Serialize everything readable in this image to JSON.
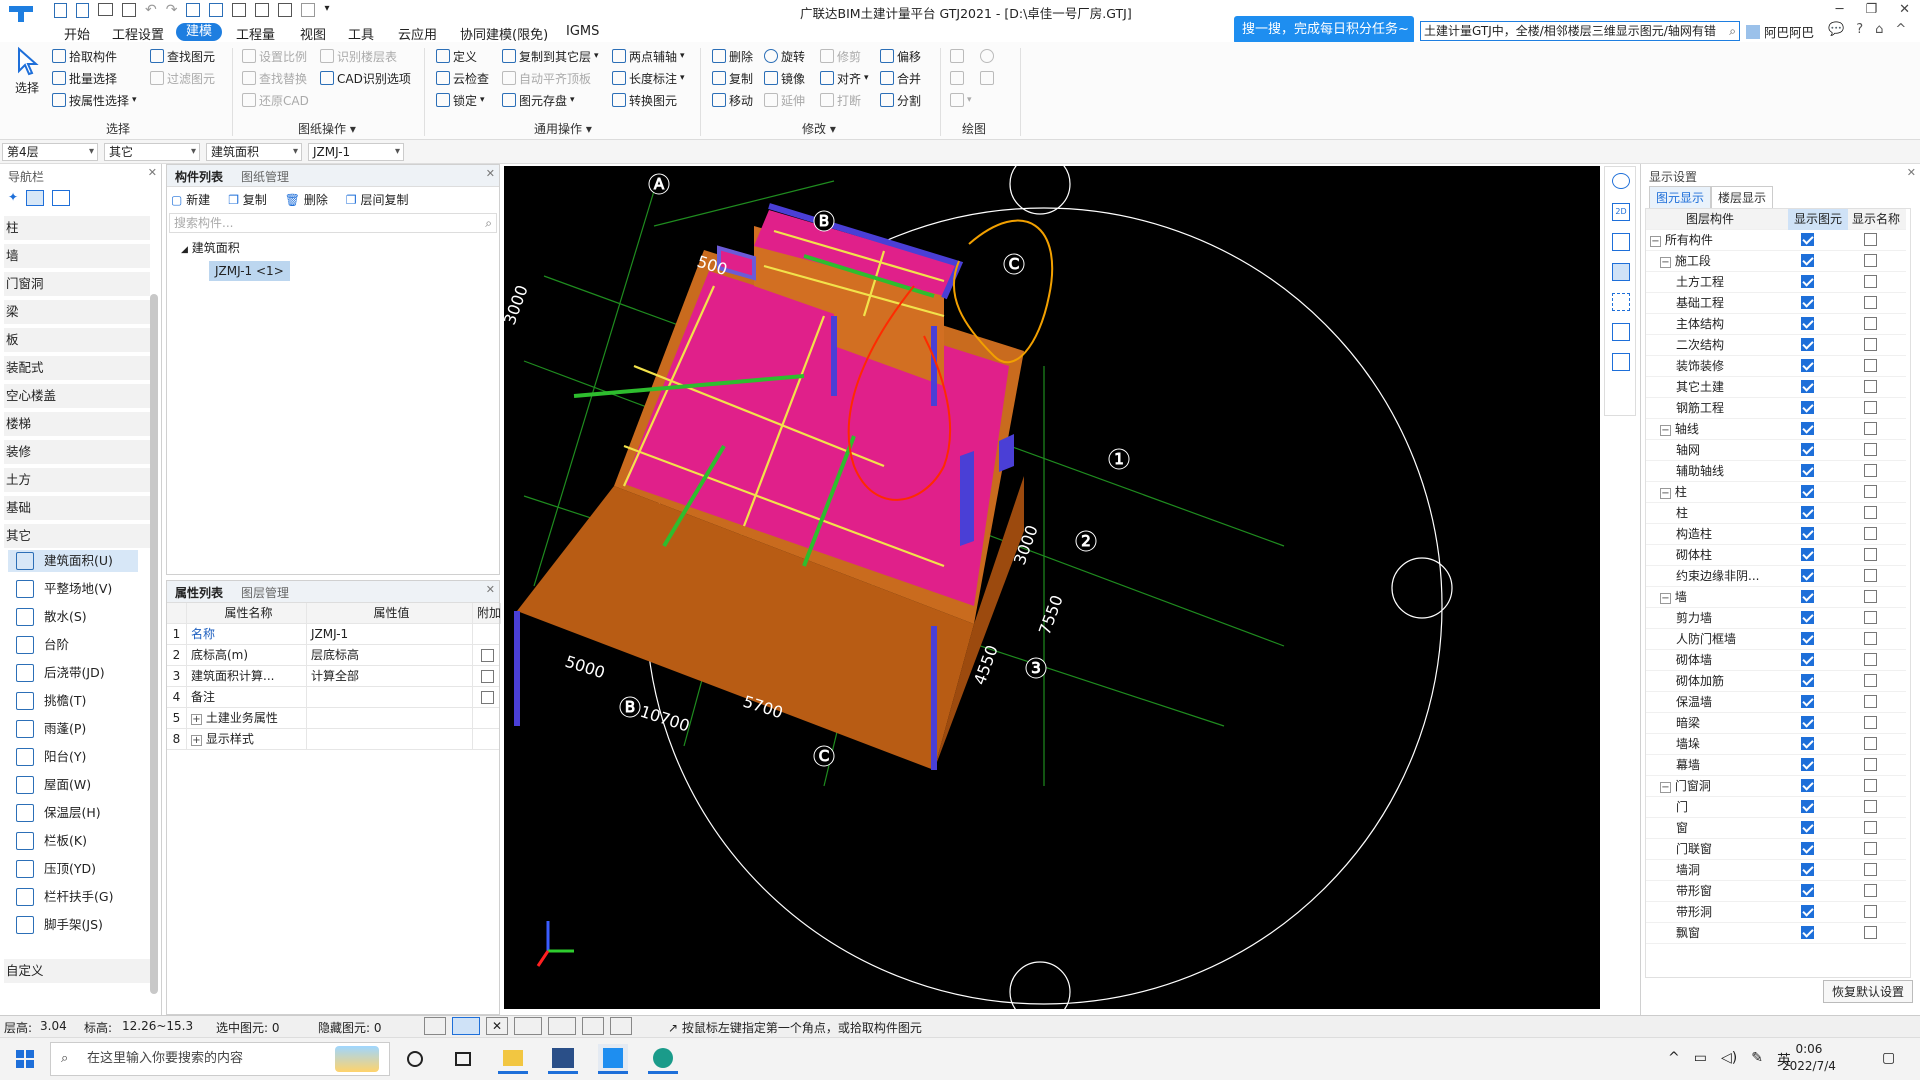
{
  "title": {
    "text": "广联达BIM土建计量平台 GTJ2021 - [D:\\卓佳一号厂房.GTJ]"
  },
  "promo": {
    "text": "搜一搜，完成每日积分任务~"
  },
  "search": {
    "value": "土建计量GTJ中，全楼/相邻楼层三维显示图元/轴网有错"
  },
  "user": {
    "name": "阿巴阿巴"
  },
  "tabs": [
    "开始",
    "工程设置",
    "建模",
    "工程量",
    "视图",
    "工具",
    "云应用",
    "协同建模(限免)",
    "IGMS"
  ],
  "ribbon": {
    "select": "选择",
    "select_group": {
      "items": [
        "拾取构件",
        "批量选择",
        "按属性选择",
        "查找图元",
        "过滤图元"
      ],
      "label": "选择"
    },
    "drawing_group": {
      "items": [
        "设置比例",
        "识别楼层表",
        "查找替换",
        "CAD识别选项",
        "还原CAD"
      ],
      "label": "图纸操作"
    },
    "general_group": {
      "items": [
        "定义",
        "复制到其它层",
        "两点辅轴",
        "云检查",
        "自动平齐顶板",
        "长度标注",
        "锁定",
        "图元存盘",
        "转换图元"
      ],
      "label": "通用操作"
    },
    "modify_group": {
      "items": [
        "删除",
        "旋转",
        "修剪",
        "偏移",
        "复制",
        "镜像",
        "对齐",
        "合并",
        "移动",
        "延伸",
        "打断",
        "分割"
      ],
      "label": "修改"
    },
    "draw_group": {
      "label": "绘图"
    }
  },
  "filters": [
    "第4层",
    "其它",
    "建筑面积",
    "JZMJ-1"
  ],
  "nav": {
    "title": "导航栏",
    "cats": [
      "柱",
      "墙",
      "门窗洞",
      "梁",
      "板",
      "装配式",
      "空心楼盖",
      "楼梯",
      "装修",
      "土方",
      "基础",
      "其它"
    ],
    "items": [
      "建筑面积(U)",
      "平整场地(V)",
      "散水(S)",
      "台阶",
      "后浇带(JD)",
      "挑檐(T)",
      "雨蓬(P)",
      "阳台(Y)",
      "屋面(W)",
      "保温层(H)",
      "栏板(K)",
      "压顶(YD)",
      "栏杆扶手(G)",
      "脚手架(JS)"
    ],
    "custom": "自定义"
  },
  "comp": {
    "tabs": [
      "构件列表",
      "图纸管理"
    ],
    "actions": [
      "新建",
      "复制",
      "删除",
      "层间复制"
    ],
    "search_placeholder": "搜索构件...",
    "tree_root": "建筑面积",
    "tree_item": "JZMJ-1 <1>"
  },
  "props": {
    "tabs": [
      "属性列表",
      "图层管理"
    ],
    "headers": [
      "属性名称",
      "属性值",
      "附加"
    ],
    "rows": [
      {
        "no": "1",
        "name": "名称",
        "value": "JZMJ-1",
        "cb": false,
        "hascb": false
      },
      {
        "no": "2",
        "name": "底标高(m)",
        "value": "层底标高",
        "cb": false,
        "hascb": true
      },
      {
        "no": "3",
        "name": "建筑面积计算...",
        "value": "计算全部",
        "cb": false,
        "hascb": true
      },
      {
        "no": "4",
        "name": "备注",
        "value": "",
        "cb": false,
        "hascb": true
      },
      {
        "no": "5",
        "name": "土建业务属性",
        "value": "",
        "cb": false,
        "hascb": false
      },
      {
        "no": "8",
        "name": "显示样式",
        "value": "",
        "cb": false,
        "hascb": false
      }
    ]
  },
  "viewport": {
    "axis_labels": [
      "A",
      "B",
      "C",
      "1",
      "2",
      "3",
      "1",
      "2",
      "3",
      "A",
      "B",
      "C"
    ],
    "dims": [
      "500",
      "3000",
      "7550",
      "4550",
      "5000",
      "5700",
      "10700",
      "3000",
      "7550",
      "4550"
    ]
  },
  "display": {
    "title": "显示设置",
    "tabs": [
      "图元显示",
      "楼层显示"
    ],
    "headers": [
      "图层构件",
      "显示图元",
      "显示名称"
    ],
    "rows": [
      {
        "t": "所有构件",
        "lvl": 0,
        "exp": "−",
        "a": true,
        "b": false
      },
      {
        "t": "施工段",
        "lvl": 1,
        "exp": "−",
        "a": true,
        "b": false
      },
      {
        "t": "土方工程",
        "lvl": 2,
        "exp": "",
        "a": true,
        "b": false
      },
      {
        "t": "基础工程",
        "lvl": 2,
        "exp": "",
        "a": true,
        "b": false
      },
      {
        "t": "主体结构",
        "lvl": 2,
        "exp": "",
        "a": true,
        "b": false
      },
      {
        "t": "二次结构",
        "lvl": 2,
        "exp": "",
        "a": true,
        "b": false
      },
      {
        "t": "装饰装修",
        "lvl": 2,
        "exp": "",
        "a": true,
        "b": false
      },
      {
        "t": "其它土建",
        "lvl": 2,
        "exp": "",
        "a": true,
        "b": false
      },
      {
        "t": "钢筋工程",
        "lvl": 2,
        "exp": "",
        "a": true,
        "b": false
      },
      {
        "t": "轴线",
        "lvl": 1,
        "exp": "−",
        "a": true,
        "b": false
      },
      {
        "t": "轴网",
        "lvl": 2,
        "exp": "",
        "a": true,
        "b": false
      },
      {
        "t": "辅助轴线",
        "lvl": 2,
        "exp": "",
        "a": true,
        "b": false
      },
      {
        "t": "柱",
        "lvl": 1,
        "exp": "−",
        "a": true,
        "b": false
      },
      {
        "t": "柱",
        "lvl": 2,
        "exp": "",
        "a": true,
        "b": false
      },
      {
        "t": "构造柱",
        "lvl": 2,
        "exp": "",
        "a": true,
        "b": false
      },
      {
        "t": "砌体柱",
        "lvl": 2,
        "exp": "",
        "a": true,
        "b": false
      },
      {
        "t": "约束边缘非阴...",
        "lvl": 2,
        "exp": "",
        "a": true,
        "b": false
      },
      {
        "t": "墙",
        "lvl": 1,
        "exp": "−",
        "a": true,
        "b": false
      },
      {
        "t": "剪力墙",
        "lvl": 2,
        "exp": "",
        "a": true,
        "b": false
      },
      {
        "t": "人防门框墙",
        "lvl": 2,
        "exp": "",
        "a": true,
        "b": false
      },
      {
        "t": "砌体墙",
        "lvl": 2,
        "exp": "",
        "a": true,
        "b": false
      },
      {
        "t": "砌体加筋",
        "lvl": 2,
        "exp": "",
        "a": true,
        "b": false
      },
      {
        "t": "保温墙",
        "lvl": 2,
        "exp": "",
        "a": true,
        "b": false
      },
      {
        "t": "暗梁",
        "lvl": 2,
        "exp": "",
        "a": true,
        "b": false
      },
      {
        "t": "墙垛",
        "lvl": 2,
        "exp": "",
        "a": true,
        "b": false
      },
      {
        "t": "幕墙",
        "lvl": 2,
        "exp": "",
        "a": true,
        "b": false
      },
      {
        "t": "门窗洞",
        "lvl": 1,
        "exp": "−",
        "a": true,
        "b": false
      },
      {
        "t": "门",
        "lvl": 2,
        "exp": "",
        "a": true,
        "b": false
      },
      {
        "t": "窗",
        "lvl": 2,
        "exp": "",
        "a": true,
        "b": false
      },
      {
        "t": "门联窗",
        "lvl": 2,
        "exp": "",
        "a": true,
        "b": false
      },
      {
        "t": "墙洞",
        "lvl": 2,
        "exp": "",
        "a": true,
        "b": false
      },
      {
        "t": "带形窗",
        "lvl": 2,
        "exp": "",
        "a": true,
        "b": false
      },
      {
        "t": "带形洞",
        "lvl": 2,
        "exp": "",
        "a": true,
        "b": false
      },
      {
        "t": "飘窗",
        "lvl": 2,
        "exp": "",
        "a": true,
        "b": false
      }
    ],
    "restore": "恢复默认设置"
  },
  "status": {
    "floor_h": "层高:",
    "floor_h_val": "3.04",
    "elev": "标高:",
    "elev_val": "12.26~15.3",
    "sel": "选中图元: 0",
    "hidden": "隐藏图元: 0",
    "hint": "按鼠标左键指定第一个角点，或拾取构件图元"
  },
  "taskbar": {
    "search_placeholder": "在这里输入你要搜索的内容",
    "ime": "英",
    "time": "0:06",
    "date": "2022/7/4"
  }
}
